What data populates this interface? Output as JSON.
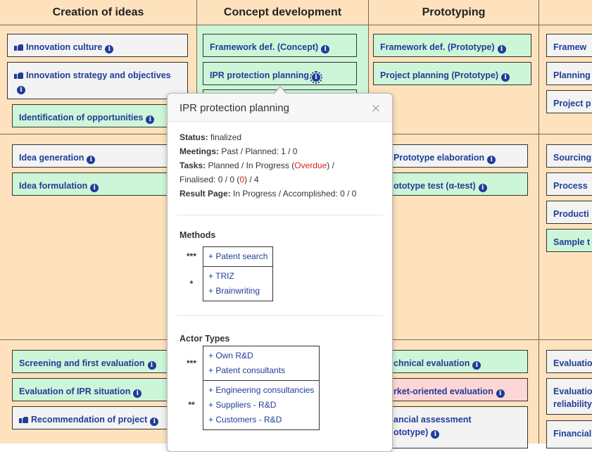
{
  "columns": [
    "Creation of ideas",
    "Concept development",
    "Prototyping"
  ],
  "cards": {
    "innovation_culture": "Innovation culture",
    "innovation_strategy": "Innovation strategy and objectives",
    "identification": "Identification of opportunities",
    "idea_generation": "Idea generation",
    "idea_formulation": "Idea formulation",
    "screening": "Screening and first evaluation",
    "eval_ipr": "Evaluation of IPR situation",
    "recommendation": "Recommendation of project",
    "framework_concept": "Framework def. (Concept)",
    "ipr_planning": "IPR protection planning",
    "framework_proto": "Framework def. (Prototype)",
    "project_planning_proto": "Project planning (Prototype)",
    "proto_elab": "Prototype elaboration",
    "proto_test": "ototype test (α-test)",
    "tech_eval": "chnical evaluation",
    "market_eval": "rket-oriented evaluation",
    "fin_assess_1": "ancial assessment",
    "fin_assess_2": "ototype)",
    "c4_framew": "Framew",
    "c4_planning": "Planning",
    "c4_projectp": "Project p",
    "c4_sourcing": "Sourcing",
    "c4_process": "Process",
    "c4_producti": "Producti",
    "c4_sample": "Sample t",
    "c4_evaluatio": "Evaluatio",
    "c4_evaluatio2a": "Evaluatio",
    "c4_evaluatio2b": "reliability",
    "c4_financial": "Financial"
  },
  "popover": {
    "title": "IPR protection planning",
    "close": "×",
    "status_label": "Status:",
    "status_value": "finalized",
    "meetings_label": "Meetings:",
    "meetings_value": "Past / Planned: 1 / 0",
    "tasks_label": "Tasks:",
    "tasks_text1": "Planned / In Progress (",
    "tasks_overdue": "Overdue",
    "tasks_text2": ") /",
    "tasks_line2a": "Finalised: 0 / 0 (",
    "tasks_line2_red": "0",
    "tasks_line2b": ") / 4",
    "result_label": "Result Page:",
    "result_value": "In Progress / Accomplished: 0 / 0",
    "methods_title": "Methods",
    "methods": [
      {
        "stars": "***",
        "items": [
          "+ Patent search"
        ]
      },
      {
        "stars": "*",
        "items": [
          "+ TRIZ",
          "+ Brainwriting"
        ]
      }
    ],
    "actors_title": "Actor Types",
    "actors": [
      {
        "stars": "***",
        "items": [
          "+ Own R&D",
          "+ Patent consultants"
        ]
      },
      {
        "stars": "**",
        "items": [
          "+ Engineering consultancies",
          "+ Suppliers - R&D",
          "+ Customers - R&D"
        ]
      }
    ]
  },
  "colors": {
    "band": "#fde2bd",
    "green": "#cdf6d9",
    "grey": "#f3f3f3",
    "pink": "#ffd6d6",
    "link": "#1f3d99"
  }
}
